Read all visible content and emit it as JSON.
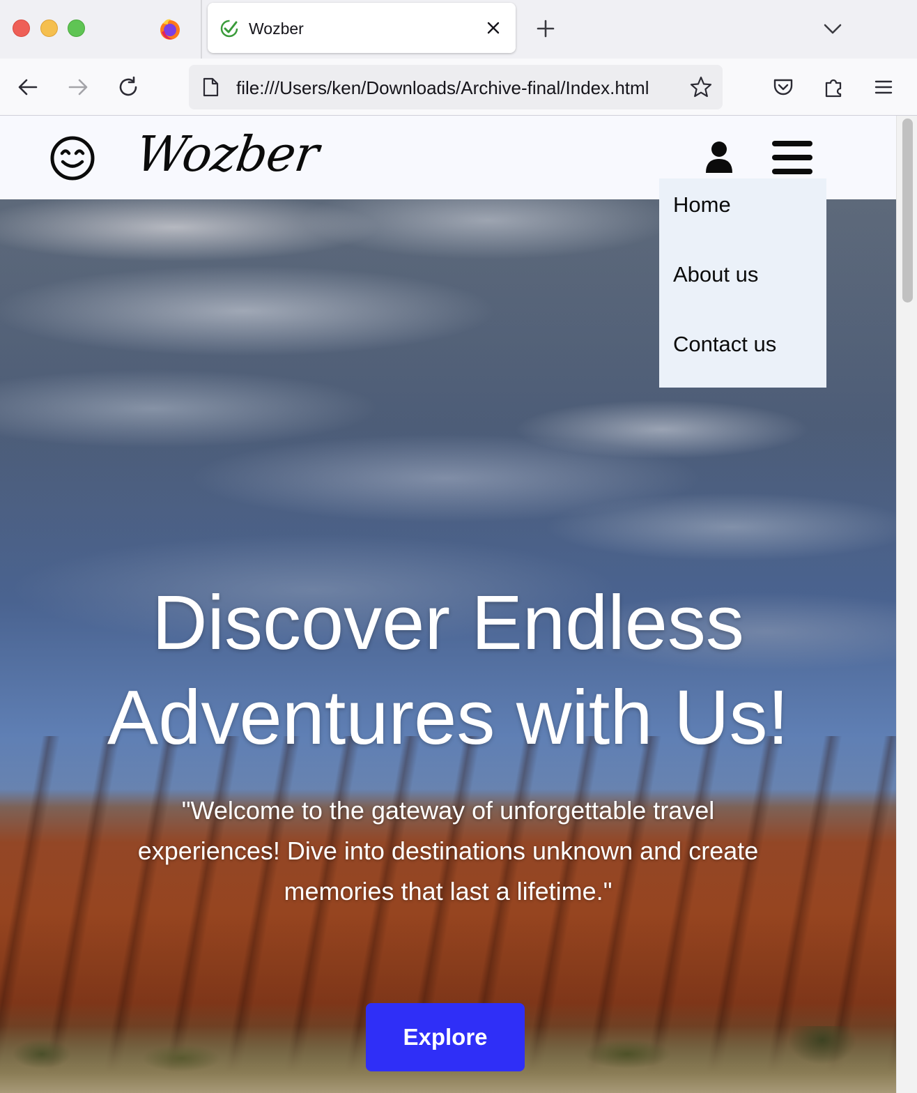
{
  "browser": {
    "tab_title": "Wozber",
    "url": "file:///Users/ken/Downloads/Archive-final/Index.html"
  },
  "site": {
    "brand": "Wozber",
    "menu": [
      {
        "label": "Home"
      },
      {
        "label": "About us"
      },
      {
        "label": "Contact us"
      }
    ],
    "hero": {
      "title_line1": "Discover Endless",
      "title_line2": "Adventures with Us!",
      "subtitle": "\"Welcome to the gateway of unforgettable travel experiences! Dive into destinations unknown and create memories that last a lifetime.\"",
      "cta_label": "Explore"
    },
    "colors": {
      "cta": "#2f2ff7",
      "header_bg": "#f8f9fe",
      "dropdown_bg": "#ebf1f9"
    }
  }
}
